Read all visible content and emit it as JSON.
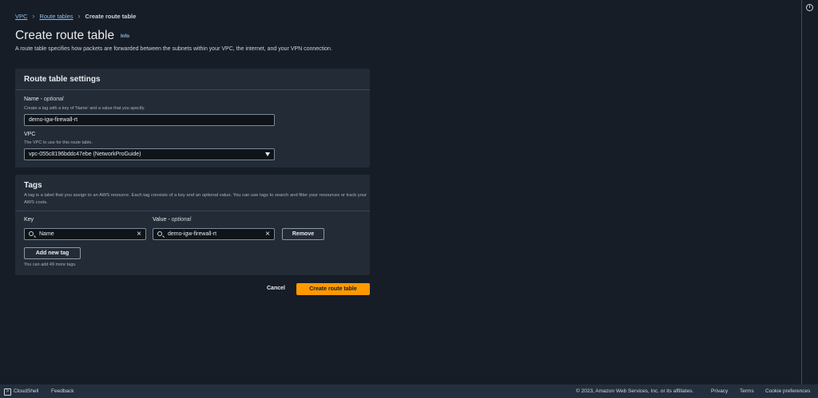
{
  "breadcrumb": {
    "vpc": "VPC",
    "route_tables": "Route tables",
    "current": "Create route table"
  },
  "page": {
    "title": "Create route table",
    "info": "Info",
    "description": "A route table specifies how packets are forwarded between the subnets within your VPC, the internet, and your VPN connection."
  },
  "settings": {
    "header": "Route table settings",
    "name_label": "Name - ",
    "name_optional": "optional",
    "name_hint": "Create a tag with a key of 'Name' and a value that you specify.",
    "name_value": "demo-igw-firewall-rt",
    "vpc_label": "VPC",
    "vpc_hint": "The VPC to use for this route table.",
    "vpc_value": "vpc-055c8196bddc47ebe (NetworkProGuide)"
  },
  "tags": {
    "header": "Tags",
    "description": "A tag is a label that you assign to an AWS resource. Each tag consists of a key and an optional value. You can use tags to search and filter your resources or track your AWS costs.",
    "key_label": "Key",
    "value_label": "Value - ",
    "value_optional": "optional",
    "rows": [
      {
        "key": "Name",
        "value": "demo-igw-firewall-rt"
      }
    ],
    "remove_label": "Remove",
    "add_label": "Add new tag",
    "limit_hint": "You can add 49 more tags."
  },
  "actions": {
    "cancel": "Cancel",
    "create": "Create route table"
  },
  "footer": {
    "cloudshell": "CloudShell",
    "feedback": "Feedback",
    "copyright": "© 2023, Amazon Web Services, Inc. or its affiliates.",
    "privacy": "Privacy",
    "terms": "Terms",
    "cookies": "Cookie preferences"
  },
  "colors": {
    "accent": "#ff9900",
    "link": "#89bdee",
    "background": "#161d26",
    "panel": "#232b37"
  }
}
